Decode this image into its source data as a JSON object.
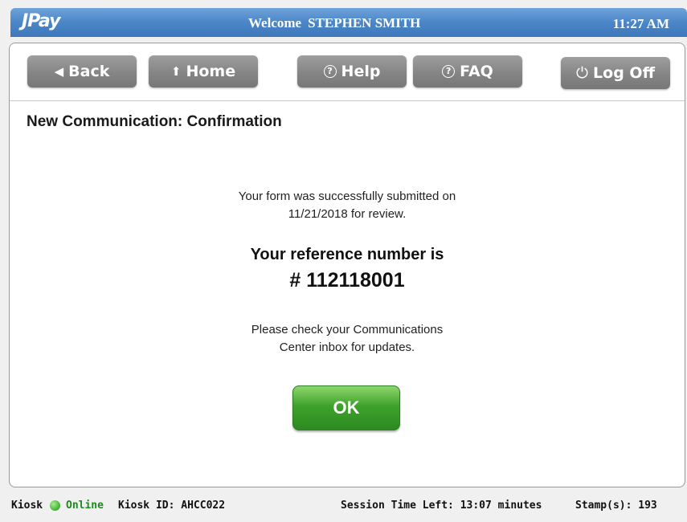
{
  "header": {
    "logo": "JPay",
    "welcome_label": "Welcome",
    "user_name": "STEPHEN SMITH",
    "time": "11:27 AM"
  },
  "nav": {
    "back": "Back",
    "home": "Home",
    "help": "Help",
    "faq": "FAQ",
    "log_off": "Log Off"
  },
  "page": {
    "title": "New Communication: Confirmation",
    "message_line1": "Your form was successfully submitted on",
    "message_line2": "11/21/2018 for review.",
    "reference_label": "Your reference number is",
    "reference_number": "# 112118001",
    "check_line1": "Please check your Communications",
    "check_line2": "Center inbox for updates.",
    "ok_button": "OK"
  },
  "footer": {
    "kiosk_label": "Kiosk",
    "status": "Online",
    "kiosk_id": "Kiosk ID: AHCC022",
    "session_time": "Session Time Left: 13:07 minutes",
    "stamps": "Stamp(s):  193"
  },
  "colors": {
    "header_blue": "#4a86c8",
    "nav_gray": "#858585",
    "ok_green": "#3fa22c",
    "online_green": "#1d8a1d"
  }
}
